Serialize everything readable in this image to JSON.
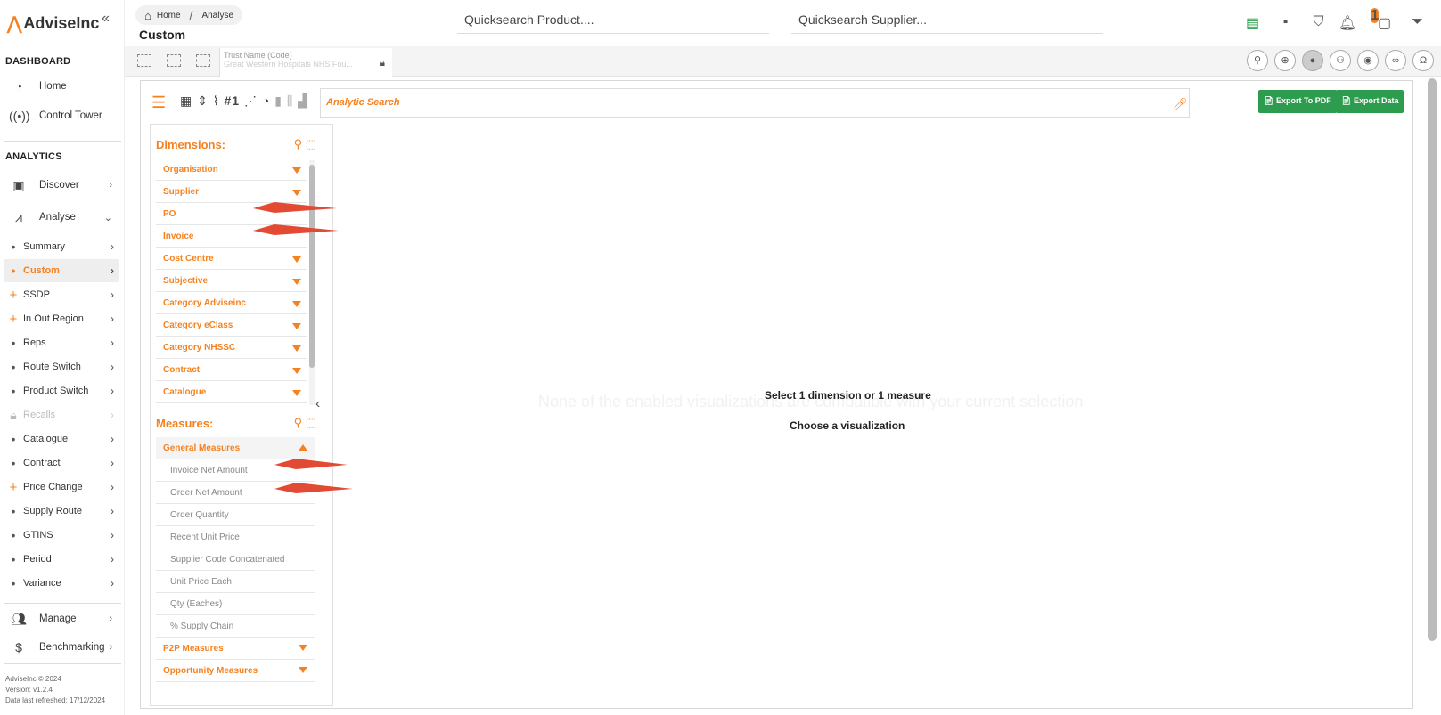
{
  "brand": {
    "name": "AdviseInc",
    "accent": "#f58220",
    "green": "#2e9c4e"
  },
  "sidebar": {
    "dashboard_heading": "DASHBOARD",
    "dashboard_items": [
      {
        "label": "Home",
        "icon": "speedometer-icon"
      },
      {
        "label": "Control Tower",
        "icon": "broadcast-tower-icon"
      }
    ],
    "analytics_heading": "ANALYTICS",
    "discover": "Discover",
    "analyse": "Analyse",
    "analyse_items": [
      {
        "label": "Summary",
        "bullet": "•"
      },
      {
        "label": "Custom",
        "bullet": "•"
      },
      {
        "label": "SSDP",
        "bullet": "+"
      },
      {
        "label": "In Out Region",
        "bullet": "+"
      },
      {
        "label": "Reps",
        "bullet": "•"
      },
      {
        "label": "Route Switch",
        "bullet": "•"
      },
      {
        "label": "Product Switch",
        "bullet": "•"
      },
      {
        "label": "Recalls",
        "bullet": "lock"
      },
      {
        "label": "Catalogue",
        "bullet": "•"
      },
      {
        "label": "Contract",
        "bullet": "•"
      },
      {
        "label": "Price Change",
        "bullet": "+"
      },
      {
        "label": "Supply Route",
        "bullet": "•"
      },
      {
        "label": "GTINS",
        "bullet": "•"
      },
      {
        "label": "Period",
        "bullet": "•"
      },
      {
        "label": "Variance",
        "bullet": "•"
      }
    ],
    "manage": "Manage",
    "benchmarking": "Benchmarking",
    "footer": {
      "copyright": "AdviseInc © 2024",
      "version": "Version: v1.2.4",
      "refreshed": "Data last refreshed: 17/12/2024"
    }
  },
  "header": {
    "breadcrumb": {
      "home": "Home",
      "current": "Analyse"
    },
    "title": "Custom",
    "quicksearch_product": "Quicksearch Product....",
    "quicksearch_supplier": "Quicksearch Supplier...",
    "notification_count": "1"
  },
  "trust": {
    "label": "Trust Name (Code)",
    "value": "Great Western Hospitals NHS Fou..."
  },
  "analytic_search": {
    "placeholder": "Analytic Search"
  },
  "export": {
    "pdf": "Export To PDF",
    "data": "Export Data"
  },
  "viz_icon_glyphs": {
    "table": "▦",
    "pivot": "⇕",
    "line": "⌇",
    "kpi": "#1",
    "scatter": "⋰",
    "pie": "◔",
    "bar": "▮",
    "combo": "⫼",
    "waterfall": "▟"
  },
  "dimensions": {
    "heading": "Dimensions:",
    "items": [
      "Organisation",
      "Supplier",
      "PO",
      "Invoice",
      "Cost Centre",
      "Subjective",
      "Category Adviseinc",
      "Category eClass",
      "Category NHSSC",
      "Contract",
      "Catalogue"
    ]
  },
  "measures": {
    "heading": "Measures:",
    "general": "General Measures",
    "items": [
      "Invoice Net Amount",
      "Order Net Amount",
      "Order Quantity",
      "Recent Unit Price",
      "Supplier Code Concatenated",
      "Unit Price Each",
      "Qty (Eaches)",
      "% Supply Chain"
    ],
    "p2p": "P2P Measures",
    "opportunity": "Opportunity Measures"
  },
  "canvas": {
    "message1": "Select 1 dimension or 1 measure",
    "message2": "Choose a visualization",
    "ghost": "None of the enabled visualizations are compatible with your current selection"
  }
}
